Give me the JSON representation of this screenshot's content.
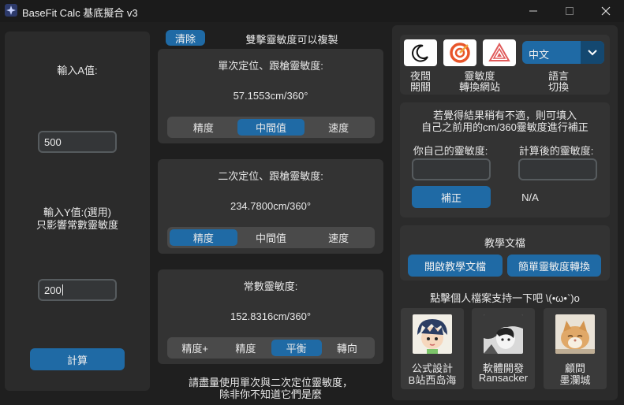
{
  "window": {
    "title": "BaseFit Calc 基底擬合 v3",
    "minimize_icon": "minimize-icon",
    "maximize_icon": "maximize-icon",
    "close_icon": "close-icon"
  },
  "left_panel": {
    "input_a_label": "輸入A值:",
    "input_a_value": "500",
    "input_y_label_line1": "輸入Y值:(選用)",
    "input_y_label_line2": "只影響常數靈敏度",
    "input_y_value": "200",
    "calc_button": "計算"
  },
  "middle_panel": {
    "clear_button": "清除",
    "copy_hint": "雙擊靈敏度可以複製",
    "sections": [
      {
        "title": "單次定位、跟槍靈敏度:",
        "value": "57.1553cm/360°",
        "options": [
          "精度",
          "中間值",
          "速度"
        ],
        "selected": "中間值"
      },
      {
        "title": "二次定位、跟槍靈敏度:",
        "value": "234.7800cm/360°",
        "options": [
          "精度",
          "中間值",
          "速度"
        ],
        "selected": "精度"
      },
      {
        "title": "常數靈敏度:",
        "value": "152.8316cm/360°",
        "options": [
          "精度+",
          "精度",
          "平衡",
          "轉向"
        ],
        "selected": "平衡"
      }
    ],
    "footer_line1": "請盡量使用單次與二次定位靈敏度，",
    "footer_line2": "除非你不知道它們是麼"
  },
  "right_panel": {
    "night_label_1": "夜間",
    "night_label_2": "開關",
    "convert_label_1": "靈敏度",
    "convert_label_2": "轉換網站",
    "lang_label_1": "語言",
    "lang_label_2": "切換",
    "language_selected": "中文",
    "icons": {
      "night": "moon-icon",
      "convert_site": "sensitivity-converter-logo-icon",
      "third": "triangle-logo-icon",
      "dropdown": "chevron-down-icon"
    },
    "correction_line1": "若覺得結果稍有不適，則可填入",
    "correction_line2": "自己之前用的cm/360靈敏度進行補正",
    "own_sens_label": "你自己的靈敏度:",
    "calc_sens_label": "計算後的靈敏度:",
    "own_sens_value": "",
    "calc_sens_value": "",
    "correct_button": "補正",
    "correct_result": "N/A",
    "tutorial_title": "教學文檔",
    "open_tutorial_button": "開啟教學文檔",
    "simple_convert_button": "簡單靈敏度轉換",
    "support_text": "點擊個人檔案支持一下吧 \\(•ω•`)o",
    "profiles": [
      {
        "role": "公式設計",
        "name": "B站西岛海",
        "icon": "cartoon-avatar-icon"
      },
      {
        "role": "軟體開發",
        "name": "Ransacker",
        "icon": "photo-avatar-icon"
      },
      {
        "role": "顧問",
        "name": "墨瀾城",
        "icon": "cat-avatar-icon"
      }
    ]
  }
}
